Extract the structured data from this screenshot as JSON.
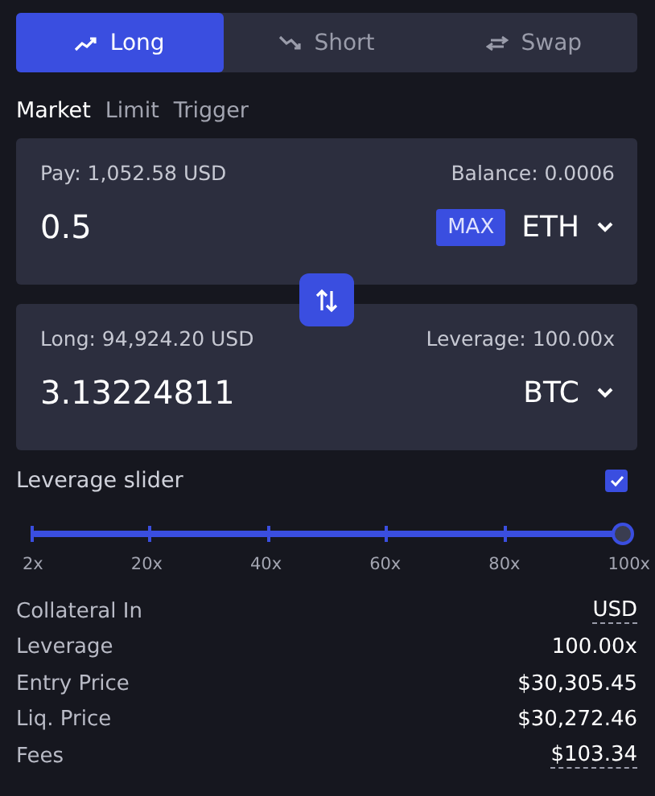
{
  "side_tabs": [
    {
      "label": "Long",
      "kind": "up",
      "selected": true
    },
    {
      "label": "Short",
      "kind": "down",
      "selected": false
    },
    {
      "label": "Swap",
      "kind": "swap",
      "selected": false
    }
  ],
  "order_tabs": [
    {
      "label": "Market",
      "selected": true
    },
    {
      "label": "Limit",
      "selected": false
    },
    {
      "label": "Trigger",
      "selected": false
    }
  ],
  "pay": {
    "label": "Pay: 1,052.58 USD",
    "balance": "Balance: 0.0006",
    "value": "0.5",
    "max": "MAX",
    "token": "ETH"
  },
  "receive": {
    "label": "Long: 94,924.20 USD",
    "leverage": "Leverage: 100.00x",
    "value": "3.13224811",
    "token": "BTC"
  },
  "leverage_slider": {
    "label": "Leverage slider",
    "checked": true,
    "level": 1,
    "ticks": [
      "2x",
      "20x",
      "40x",
      "60x",
      "80x",
      "100x"
    ]
  },
  "details": [
    {
      "label": "Collateral In",
      "value": "USD",
      "underlined": true
    },
    {
      "label": "Leverage",
      "value": "100.00x",
      "underlined": false
    },
    {
      "label": "Entry Price",
      "value": "$30,305.45",
      "underlined": false
    },
    {
      "label": "Liq. Price",
      "value": "$30,272.46",
      "underlined": false
    },
    {
      "label": "Fees",
      "value": "$103.34",
      "underlined": true
    }
  ]
}
